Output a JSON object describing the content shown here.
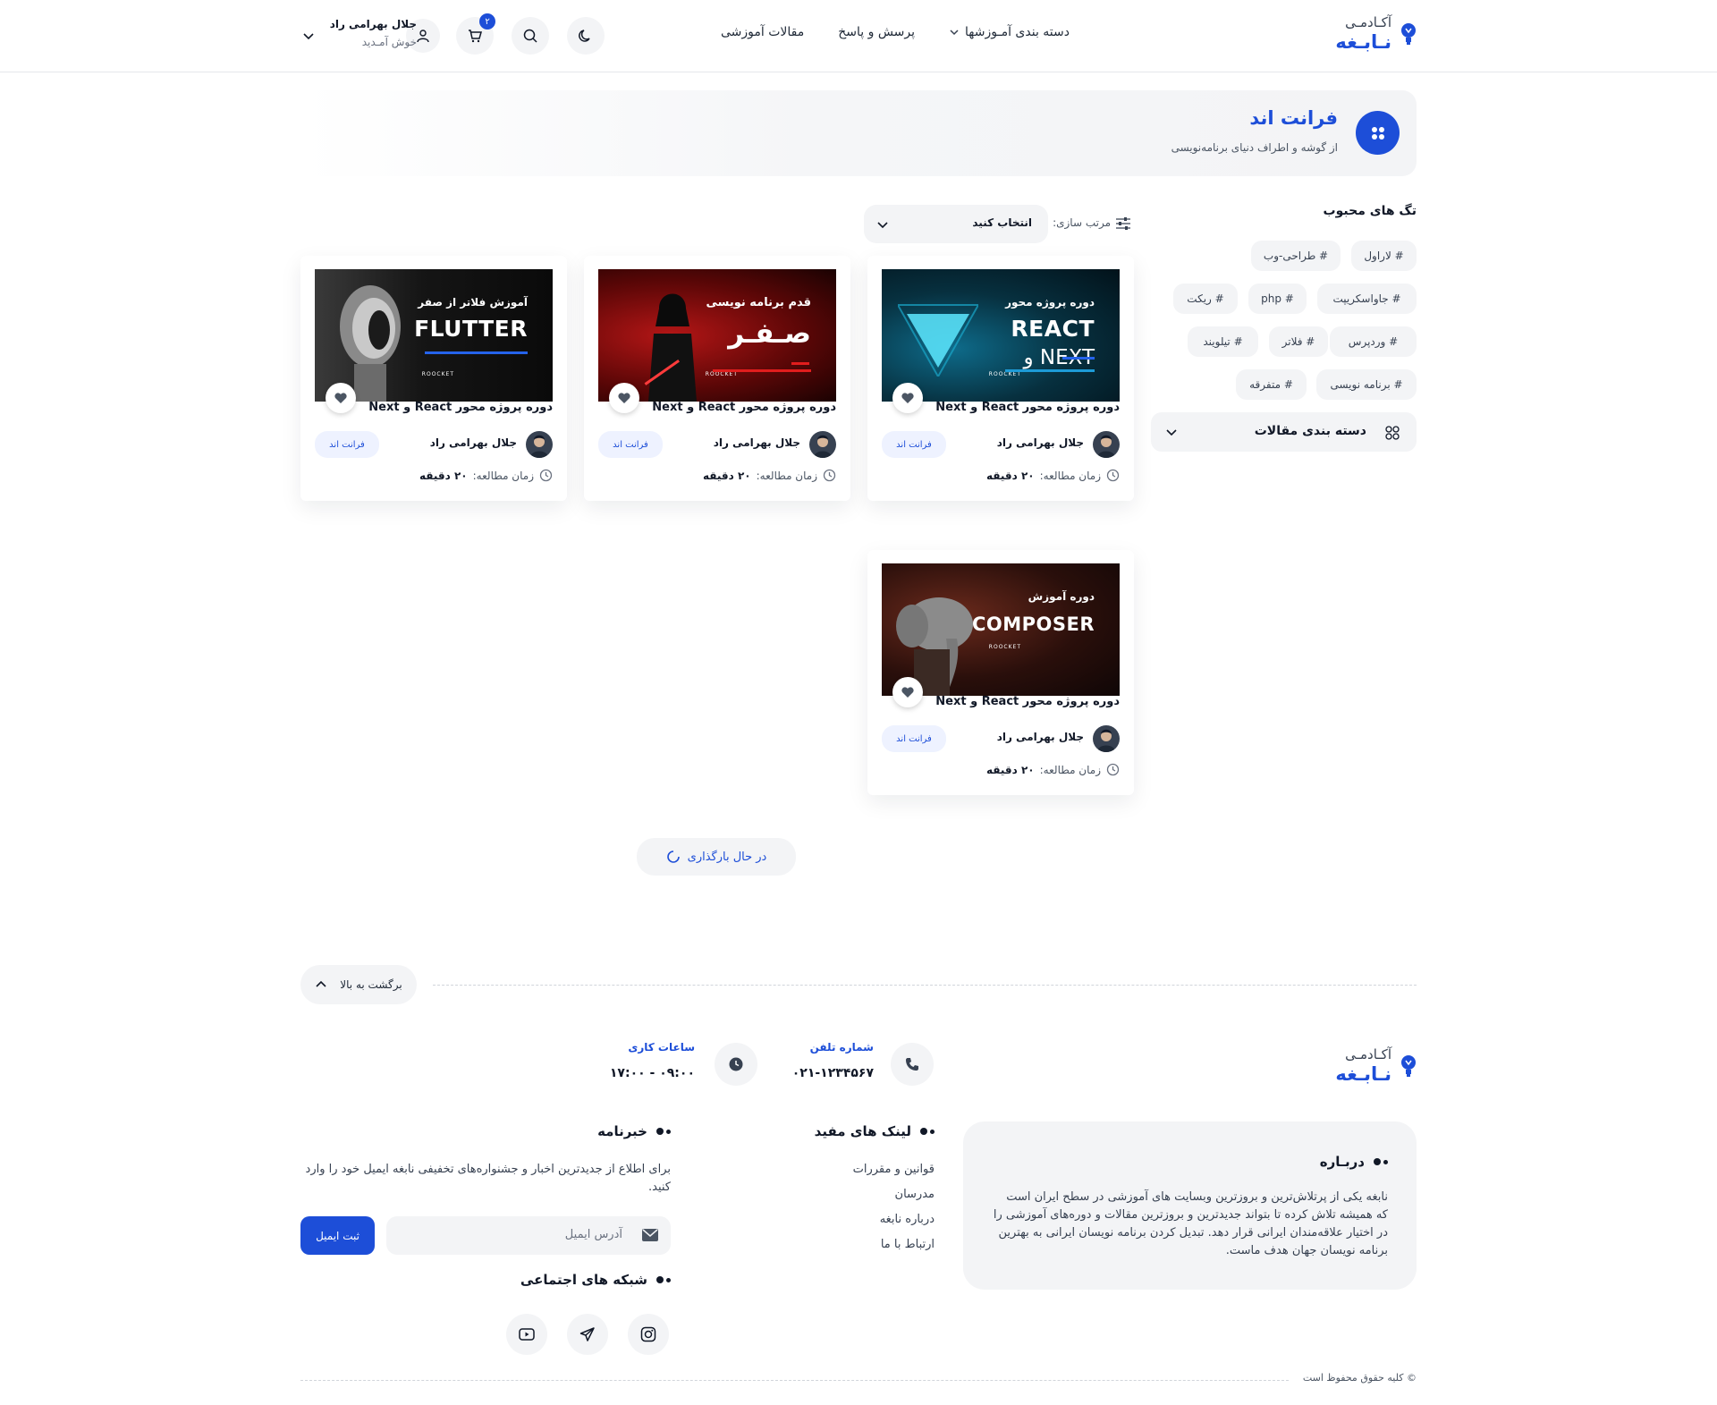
{
  "header": {
    "logo_line1": "آکـادمـی",
    "logo_line2": "نـابـغه",
    "nav": [
      "دسته بندی آمـوزشها",
      "پرسش و پاسخ",
      "مقالات آموزشی"
    ],
    "cart_count": "۲",
    "user_name": "جلال بهرامی راد",
    "user_sub": "خوش آمـدید",
    "icons": [
      "moon-icon",
      "search-icon",
      "cart-icon",
      "user-icon",
      "chevron-down-icon"
    ]
  },
  "banner": {
    "title": "فرانت اند",
    "subtitle": "از گوشه و اطراف دنیای برنامه‌نویسی"
  },
  "sidebar": {
    "tags_title": "تگ های محبوب",
    "tags": [
      "# لاراول",
      "# طراحی-وب",
      "# جاواسکریپت",
      "# php",
      "# ریکت",
      "# وردپرس",
      "# فلاتر",
      "# تیلویند",
      "# برنامه نویسی",
      "# متفرقه"
    ],
    "categories_label": "دسته بندی مقالات"
  },
  "sort": {
    "label": "مرتب سازی:",
    "value": "انتخاب کنید"
  },
  "cards": [
    {
      "thumb_line1": "دوره پروژه محور",
      "thumb_line2": "REACT",
      "thumb_line3": "NEXT و",
      "brand": "ROOCKET",
      "title": "دوره پروژه محور React و Next",
      "author": "جلال بهرامی راد",
      "category": "فرانت اند",
      "read_label": "زمان مطالعه:",
      "read_value": "۲۰ دقیقه"
    },
    {
      "thumb_line1": "قدم  برنامه نویسی",
      "thumb_line2": "صـفـر",
      "brand": "ROOCKET",
      "title": "دوره پروژه محور React و Next",
      "author": "جلال بهرامی راد",
      "category": "فرانت اند",
      "read_label": "زمان مطالعه:",
      "read_value": "۲۰ دقیقه"
    },
    {
      "thumb_line1": "آموزش فلاتر از صفر",
      "thumb_line2": "FLUTTER",
      "brand": "ROOCKET",
      "title": "دوره پروژه محور React و Next",
      "author": "جلال بهرامی راد",
      "category": "فرانت اند",
      "read_label": "زمان مطالعه:",
      "read_value": "۲۰ دقیقه"
    },
    {
      "thumb_line1": "دوره آموزش",
      "thumb_line2": "COMPOSER",
      "brand": "ROOCKET",
      "title": "دوره پروژه محور React و Next",
      "author": "جلال بهرامی راد",
      "category": "فرانت اند",
      "read_label": "زمان مطالعه:",
      "read_value": "۲۰ دقیقه"
    }
  ],
  "load_more": "در حال بارگذاری",
  "footer": {
    "back_to_top": "برگشت به بالا",
    "phone_title": "شماره تلفن",
    "phone_value": "۰۲۱-۱۲۳۴۵۶۷",
    "hours_title": "ساعات کاری",
    "hours_value": "۰۹:۰۰ - ۱۷:۰۰",
    "about_title": "دربـاره",
    "about_text": "نابغه یکی از پرتلاش‌ترین و بروزترین وبسایت های آموزشی در سطح ایران است که همیشه تلاش کرده تا بتواند جدیدترین و بروزترین مقالات و دوره‌های آموزشی را در اختیار علاقه‌مندان ایرانی قرار دهد. تبدیل کردن برنامه نویسان ایرانی به بهترین برنامه نویسان جهان هدف ماست.",
    "links_title": "لینک های مفید",
    "links": [
      "قوانین و مقررات",
      "مدرسان",
      "درباره نابغه",
      "ارتباط با ما"
    ],
    "newsletter_title": "خبرنامه",
    "newsletter_text": "برای اطلاع از جدیدترین اخبار و جشنواره‌های تخفیفی نابغه ایمیل خود را وارد کنید.",
    "email_placeholder": "آدرس ایمیل",
    "submit_label": "ثبت ایمیل",
    "social_title": "شبکه های اجتماعی",
    "copyright": "© کلیه حقوق محفوظ است"
  },
  "colors": {
    "accent": "#1d4ed8",
    "surface": "#f3f4f6",
    "text": "#111827"
  }
}
